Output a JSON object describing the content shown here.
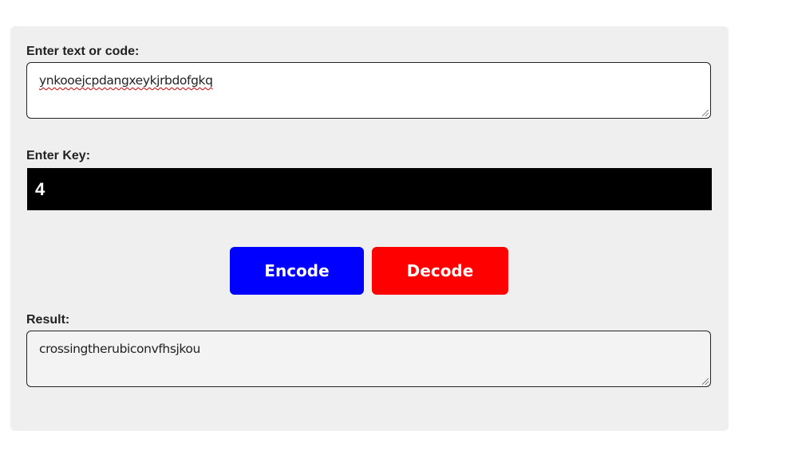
{
  "form": {
    "input_label": "Enter text or code:",
    "input_value": "ynkooejcpdangxeykjrbdofgkq",
    "key_label": "Enter Key:",
    "key_value": "4",
    "encode_label": "Encode",
    "decode_label": "Decode",
    "result_label": "Result:",
    "result_value": "crossingtherubiconvfhsjkou"
  },
  "colors": {
    "panel_bg": "#efefef",
    "key_bg": "#000000",
    "encode_bg": "#0000ff",
    "decode_bg": "#ff0000"
  }
}
